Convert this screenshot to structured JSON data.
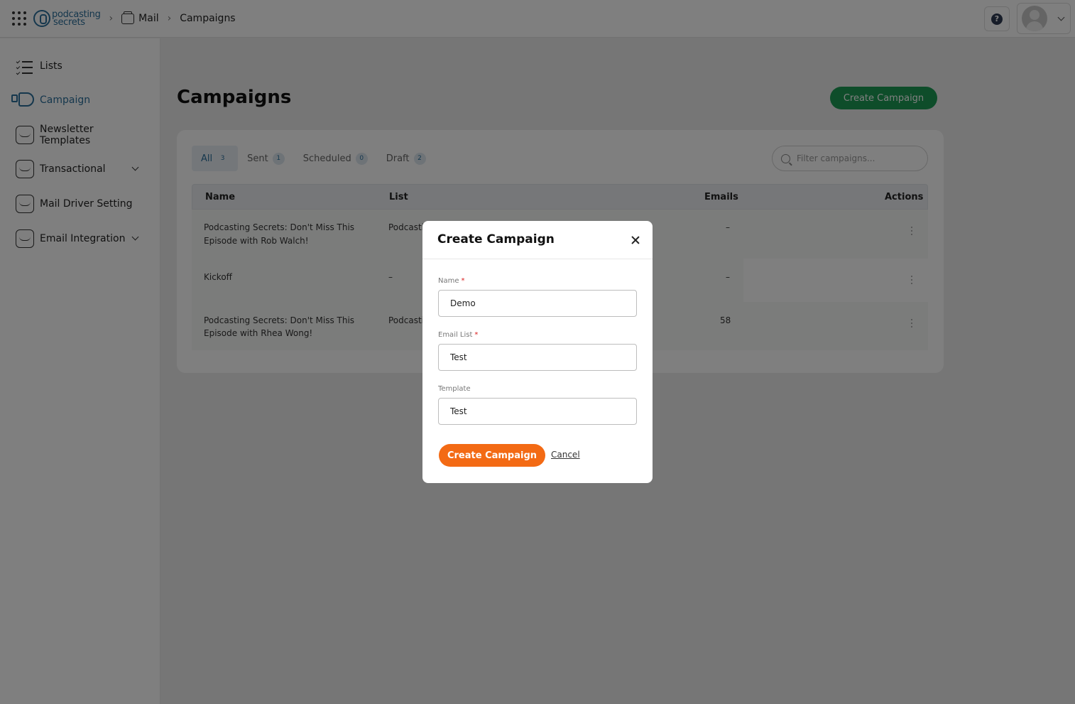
{
  "header": {
    "logo_line1": "podcasting",
    "logo_line2": "secrets",
    "breadcrumb": [
      "Mail",
      "Campaigns"
    ]
  },
  "sidebar": {
    "items": [
      {
        "label": "Lists",
        "icon": "list-check-icon"
      },
      {
        "label": "Campaign",
        "icon": "megaphone-icon",
        "active": true
      },
      {
        "label": "Newsletter Templates",
        "icon": "newsletter-icon"
      },
      {
        "label": "Transactional",
        "icon": "inbox-icon",
        "expandable": true
      },
      {
        "label": "Mail Driver Setting",
        "icon": "mail-driver-icon"
      },
      {
        "label": "Email Integration",
        "icon": "inbox-icon",
        "expandable": true
      }
    ]
  },
  "main": {
    "title": "Campaigns",
    "create_button": "Create Campaign",
    "tabs": [
      {
        "label": "All",
        "count": "3"
      },
      {
        "label": "Sent",
        "count": "1"
      },
      {
        "label": "Scheduled",
        "count": "0"
      },
      {
        "label": "Draft",
        "count": "2"
      }
    ],
    "filter_placeholder": "Filter campaigns...",
    "columns": [
      "Name",
      "List",
      "Emails",
      "Actions"
    ],
    "rows": [
      {
        "name_l1": "Podcasting Secrets: Don't Miss This",
        "name_l2": "Episode with Rob Walch!",
        "list": "Podcasti",
        "emails": "–"
      },
      {
        "name_l1": "Kickoff",
        "name_l2": "",
        "list": "–",
        "emails": "–"
      },
      {
        "name_l1": "Podcasting Secrets: Don't Miss This",
        "name_l2": "Episode with Rhea Wong!",
        "list": "Podcasti",
        "emails": "58"
      }
    ]
  },
  "modal": {
    "title": "Create Campaign",
    "fields": {
      "name_label": "Name",
      "name_value": "Demo",
      "list_label": "Email List",
      "list_value": "Test",
      "template_label": "Template",
      "template_value": "Test",
      "required_mark": "*"
    },
    "submit": "Create Campaign",
    "cancel": "Cancel"
  },
  "colors": {
    "brand": "#2b6f9b",
    "green": "#1c9a55",
    "orange": "#f36a14"
  }
}
